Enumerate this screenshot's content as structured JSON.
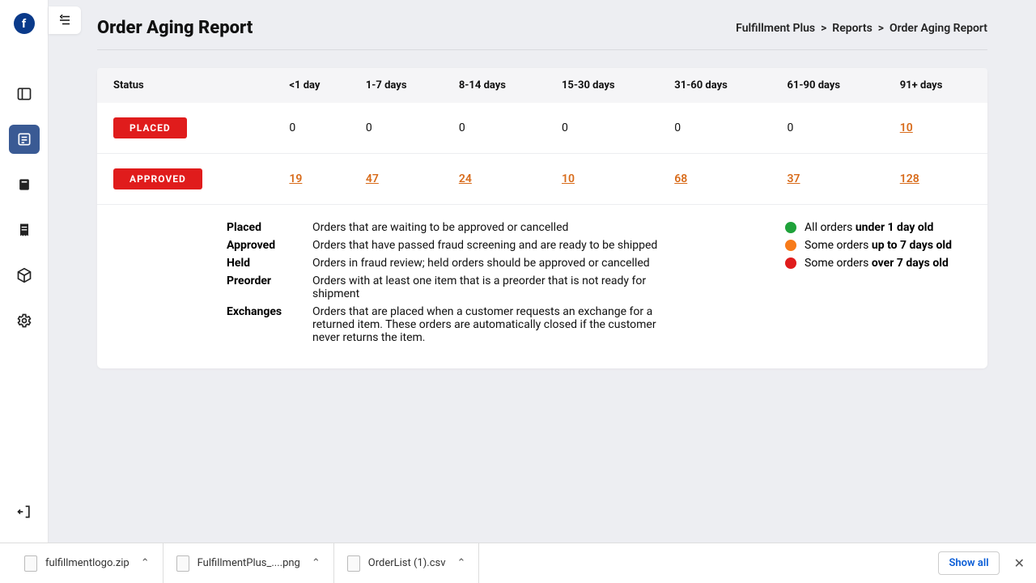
{
  "app": {
    "logo_letter": "f"
  },
  "header": {
    "title": "Order Aging Report",
    "crumbs": [
      "Fulfillment Plus",
      "Reports",
      "Order Aging Report"
    ]
  },
  "table": {
    "columns": [
      "Status",
      "<1 day",
      "1-7 days",
      "8-14 days",
      "15-30 days",
      "31-60 days",
      "61-90 days",
      "91+ days"
    ],
    "rows": [
      {
        "status": "PLACED",
        "cells": [
          "0",
          "0",
          "0",
          "0",
          "0",
          "0",
          "10"
        ],
        "links": [
          false,
          false,
          false,
          false,
          false,
          false,
          true
        ]
      },
      {
        "status": "APPROVED",
        "cells": [
          "19",
          "47",
          "24",
          "10",
          "68",
          "37",
          "128"
        ],
        "links": [
          true,
          true,
          true,
          true,
          true,
          true,
          true
        ]
      }
    ]
  },
  "definitions": [
    {
      "term": "Placed",
      "desc": "Orders that are waiting to be approved or cancelled"
    },
    {
      "term": "Approved",
      "desc": "Orders that have passed fraud screening and are ready to be shipped"
    },
    {
      "term": "Held",
      "desc": "Orders in fraud review; held orders should be approved or cancelled"
    },
    {
      "term": "Preorder",
      "desc": "Orders with at least one item that is a preorder that is not ready for shipment"
    },
    {
      "term": "Exchanges",
      "desc": "Orders that are placed when a customer requests an exchange for a returned item. These orders are automatically closed if the customer never returns the item."
    }
  ],
  "legend": [
    {
      "color": "green",
      "text": "All orders ",
      "bold": "under 1 day old"
    },
    {
      "color": "orange",
      "text": "Some orders ",
      "bold": "up to 7 days old"
    },
    {
      "color": "red",
      "text": "Some orders ",
      "bold": "over 7 days old"
    }
  ],
  "downloads": {
    "items": [
      "fulfillmentlogo.zip",
      "FulfillmentPlus_....png",
      "OrderList (1).csv"
    ],
    "show_all": "Show all"
  }
}
